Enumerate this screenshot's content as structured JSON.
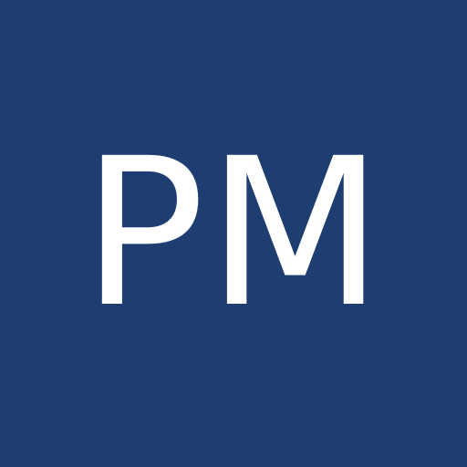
{
  "avatar": {
    "initials": "PM",
    "background_color": "#1e3d71",
    "text_color": "#ffffff"
  }
}
